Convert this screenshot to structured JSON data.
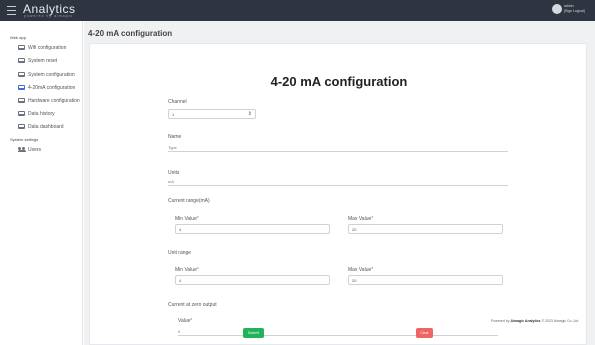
{
  "topbar": {
    "brand": "Analytics",
    "brand_sub": "powered by almagic",
    "user_name": "admin",
    "user_action": "[Sign Logout]"
  },
  "sidebar": {
    "section1": "Web app",
    "items": [
      {
        "label": "Wifi configuration"
      },
      {
        "label": "System reset"
      },
      {
        "label": "System configuration"
      },
      {
        "label": "4-20mA configuration"
      },
      {
        "label": "Hardware configuration"
      },
      {
        "label": "Data history"
      },
      {
        "label": "Data dashboard"
      }
    ],
    "section2": "System settings",
    "users_label": "Users"
  },
  "page": {
    "breadcrumb_title": "4-20 mA configuration",
    "form_title": "4-20 mA configuration"
  },
  "form": {
    "channel_label": "Channel",
    "channel_value": "1",
    "name_label": "Name",
    "name_value": "Type",
    "units_label": "Units",
    "units_value": "mA",
    "current_range_label": "Current range(mA)",
    "min_value_label": "Min Value",
    "max_value_label": "Max Value",
    "current_min": "4",
    "current_max": "20",
    "unit_range_label": "Unit range",
    "unit_min": "4",
    "unit_max": "20",
    "zero_output_label": "Current at zero output",
    "zero_value_label": "Value",
    "zero_value": "0",
    "required_mark": "*",
    "submit_label": "Submit",
    "clear_label": "Clear"
  },
  "footer": {
    "powered_by": "Powered by",
    "company": "Almagic Analytics",
    "copyright": "© 2023 Almagic Co.,Ltd"
  },
  "colors": {
    "topbar": "#2f3441",
    "active": "#3d6fd6",
    "submit": "#21b35a",
    "clear": "#f06464"
  }
}
